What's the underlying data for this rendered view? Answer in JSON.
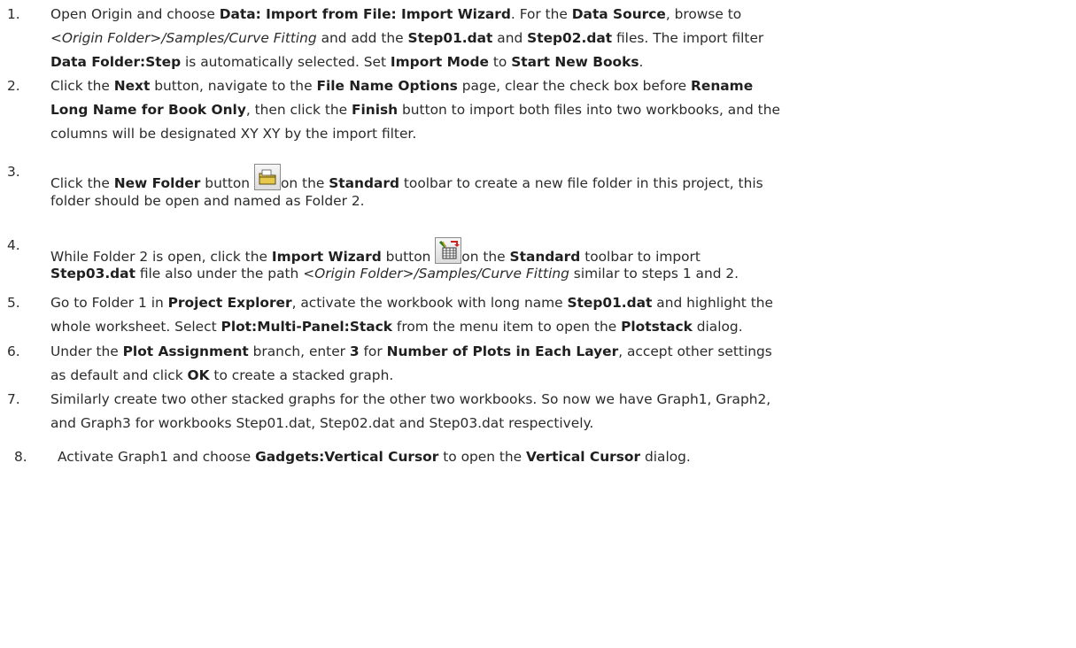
{
  "steps": [
    {
      "number": "1.",
      "lines": [
        [
          {
            "t": "Open Origin and choose "
          },
          {
            "t": "Data: Import from File: Import Wizard",
            "b": true
          },
          {
            "t": ". For the "
          },
          {
            "t": "Data Source",
            "b": true
          },
          {
            "t": ", browse to"
          }
        ],
        [
          {
            "t": "<Origin Folder>/Samples/Curve Fitting",
            "i": true
          },
          {
            "t": " and add the "
          },
          {
            "t": "Step01.dat",
            "b": true
          },
          {
            "t": " and "
          },
          {
            "t": "Step02.dat",
            "b": true
          },
          {
            "t": " files. The import filter"
          }
        ],
        [
          {
            "t": "Data Folder:Step",
            "b": true
          },
          {
            "t": " is automatically selected. Set "
          },
          {
            "t": "Import Mode",
            "b": true
          },
          {
            "t": " to "
          },
          {
            "t": "Start New Books",
            "b": true
          },
          {
            "t": "."
          }
        ]
      ]
    },
    {
      "number": "2.",
      "lines": [
        [
          {
            "t": "Click the "
          },
          {
            "t": "Next",
            "b": true
          },
          {
            "t": " button, navigate to the "
          },
          {
            "t": "File Name Options",
            "b": true
          },
          {
            "t": " page, clear the check box before "
          },
          {
            "t": "Rename",
            "b": true
          }
        ],
        [
          {
            "t": "Long Name for Book Only",
            "b": true
          },
          {
            "t": ", then click the "
          },
          {
            "t": "Finish",
            "b": true
          },
          {
            "t": " button to import both files into two workbooks, and the"
          }
        ],
        [
          {
            "t": "columns will be designated XY XY by the import filter."
          }
        ]
      ]
    },
    {
      "number": "3.",
      "lines": [
        [
          {
            "t": "Click the "
          },
          {
            "t": "New Folder",
            "b": true
          },
          {
            "t": " button "
          },
          {
            "icon": "new-folder"
          },
          {
            "t": "on the "
          },
          {
            "t": "Standard",
            "b": true
          },
          {
            "t": " toolbar to create a new file folder in this project, this"
          }
        ],
        [
          {
            "t": "folder should be open and named as Folder 2."
          }
        ]
      ]
    },
    {
      "number": "4.",
      "lines": [
        [
          {
            "t": "While Folder 2 is open, click the "
          },
          {
            "t": "Import Wizard",
            "b": true
          },
          {
            "t": " button "
          },
          {
            "icon": "import-wizard"
          },
          {
            "t": "on the "
          },
          {
            "t": "Standard",
            "b": true
          },
          {
            "t": " toolbar to import"
          }
        ],
        [
          {
            "t": "Step03.dat",
            "b": true
          },
          {
            "t": " file also under the path "
          },
          {
            "t": "<Origin Folder>/Samples/Curve Fitting",
            "i": true
          },
          {
            "t": " similar to steps 1 and 2."
          }
        ]
      ]
    },
    {
      "number": "5.",
      "lines": [
        [
          {
            "t": "Go to Folder 1 in "
          },
          {
            "t": "Project Explorer",
            "b": true
          },
          {
            "t": ", activate the workbook with long name "
          },
          {
            "t": "Step01.dat",
            "b": true
          },
          {
            "t": " and highlight the"
          }
        ],
        [
          {
            "t": "whole worksheet. Select "
          },
          {
            "t": "Plot:Multi-Panel:Stack",
            "b": true
          },
          {
            "t": " from the menu item to open the "
          },
          {
            "t": "Plotstack",
            "b": true
          },
          {
            "t": " dialog."
          }
        ]
      ]
    },
    {
      "number": "6.",
      "lines": [
        [
          {
            "t": "Under the "
          },
          {
            "t": "Plot Assignment",
            "b": true
          },
          {
            "t": " branch, enter "
          },
          {
            "t": "3",
            "b": true
          },
          {
            "t": " for "
          },
          {
            "t": "Number of Plots in Each Layer",
            "b": true
          },
          {
            "t": ", accept other settings"
          }
        ],
        [
          {
            "t": "as default and click "
          },
          {
            "t": "OK",
            "b": true
          },
          {
            "t": " to create a stacked graph."
          }
        ]
      ]
    },
    {
      "number": "7.",
      "lines": [
        [
          {
            "t": "Similarly create two other stacked graphs for the other two workbooks. So now we have Graph1, Graph2,"
          }
        ],
        [
          {
            "t": "and Graph3 for workbooks Step01.dat, Step02.dat and Step03.dat respectively."
          }
        ]
      ]
    },
    {
      "number": "8.",
      "lines": [
        [
          {
            "t": "Activate Graph1 and choose "
          },
          {
            "t": "Gadgets:Vertical Cursor",
            "b": true
          },
          {
            "t": " to open the "
          },
          {
            "t": "Vertical Cursor",
            "b": true
          },
          {
            "t": " dialog."
          }
        ]
      ]
    }
  ],
  "icons": {
    "new-folder": {
      "name": "new-folder-icon",
      "accent": "#e8c84a"
    },
    "import-wizard": {
      "name": "import-wizard-icon",
      "accent": "#2a7a2a"
    }
  }
}
